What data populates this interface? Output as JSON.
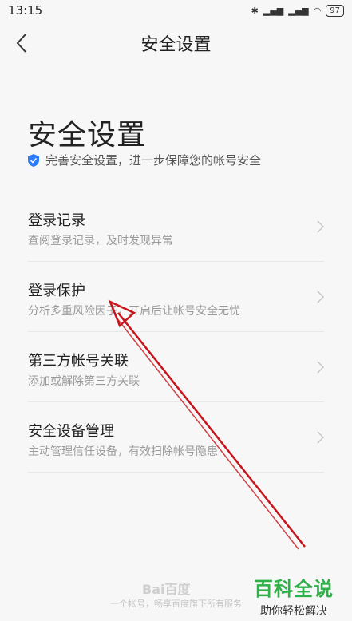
{
  "status_bar": {
    "time": "13:15",
    "battery": "97"
  },
  "header": {
    "title": "安全设置"
  },
  "page": {
    "title": "安全设置",
    "subtitle": "完善安全设置，进一步保障您的帐号安全"
  },
  "items": [
    {
      "title": "登录记录",
      "desc": "查阅登录记录，及时发现异常"
    },
    {
      "title": "登录保护",
      "desc": "分析多重风险因子，开启后让帐号安全无忧"
    },
    {
      "title": "第三方帐号关联",
      "desc": "添加或解除第三方关联"
    },
    {
      "title": "安全设备管理",
      "desc": "主动管理信任设备，有效扫除帐号隐患"
    }
  ],
  "footer": {
    "logo": "Bai百度",
    "text": "一个帐号，畅享百度旗下所有服务"
  },
  "watermark": {
    "title": "百科全说",
    "subtitle": "助你轻松解决"
  },
  "colors": {
    "accent_shield": "#2b7cf6",
    "arrow": "#c8141a",
    "watermark": "#2fb048"
  }
}
